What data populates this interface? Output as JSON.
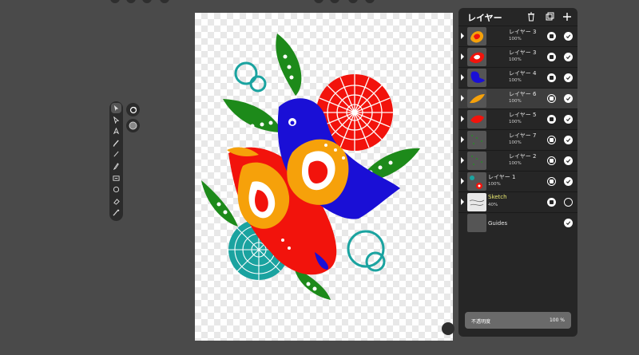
{
  "panel": {
    "title": "レイヤー",
    "header_icons": [
      "trash-icon",
      "duplicate-icon",
      "plus-icon"
    ]
  },
  "layers": [
    {
      "name": "レイヤー 3",
      "opacity": "100%",
      "thumb": "orange-paisley",
      "locked": true,
      "visible": true,
      "selected": false
    },
    {
      "name": "レイヤー 3",
      "opacity": "100%",
      "thumb": "red-paisley",
      "locked": true,
      "visible": true,
      "selected": false
    },
    {
      "name": "レイヤー 4",
      "opacity": "100%",
      "thumb": "blue-bird",
      "locked": true,
      "visible": true,
      "selected": false
    },
    {
      "name": "レイヤー 6",
      "opacity": "100%",
      "thumb": "orange-leaf",
      "locked": false,
      "visible": true,
      "selected": true
    },
    {
      "name": "レイヤー 5",
      "opacity": "100%",
      "thumb": "red-body",
      "locked": true,
      "visible": true,
      "selected": false
    },
    {
      "name": "レイヤー 7",
      "opacity": "100%",
      "thumb": "green-dots",
      "locked": false,
      "visible": true,
      "selected": false
    },
    {
      "name": "レイヤー 2",
      "opacity": "100%",
      "thumb": "green-dots",
      "locked": false,
      "visible": true,
      "selected": false
    },
    {
      "name": "レイヤー 1",
      "opacity": "100%",
      "thumb": "layer1",
      "locked": false,
      "visible": true,
      "selected": false
    },
    {
      "name": "Sketch",
      "opacity": "40%",
      "thumb": "sketch",
      "locked": true,
      "visible": false,
      "selected": false
    },
    {
      "name": "Guides",
      "opacity": "",
      "thumb": "empty",
      "locked": null,
      "visible": true,
      "selected": false
    }
  ],
  "opacity_control": {
    "label": "不透明度",
    "value": "100 %"
  },
  "colors": {
    "background": "#4a4a4a",
    "panel": "#262626",
    "blue": "#1a0fd6",
    "orange": "#f6a10a",
    "red": "#f2130c",
    "green": "#1d8a1a",
    "teal": "#1aa3a0"
  },
  "tools": [
    "select-tool-icon",
    "direct-select-icon",
    "pen-tool-icon",
    "brush-tool-icon",
    "pencil-tool-icon",
    "marker-tool-icon",
    "text-tool-icon",
    "shape-tool-icon",
    "eraser-tool-icon",
    "eyedropper-icon"
  ]
}
